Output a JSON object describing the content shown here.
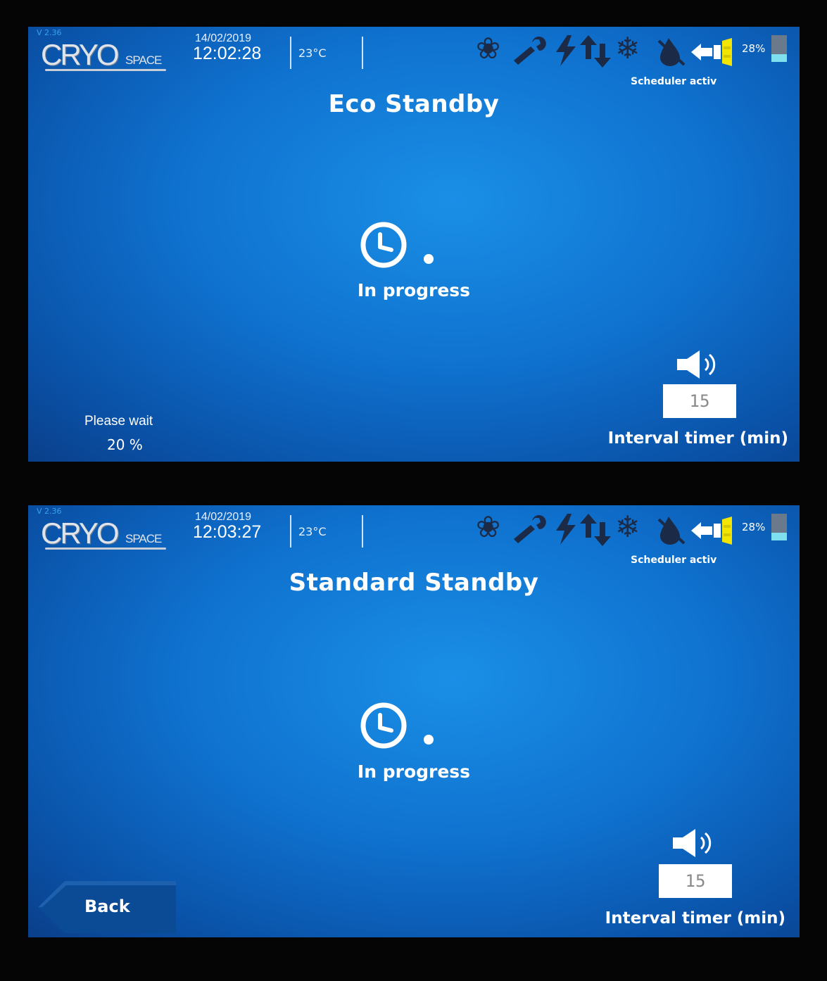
{
  "screens": [
    {
      "version": "V 2.36",
      "logo": {
        "brand": "CRYO",
        "sub": "SPACE"
      },
      "date": "14/02/2019",
      "time": "12:02:28",
      "temperature": "23°C",
      "battery": "28%",
      "battery_level": 0.28,
      "scheduler": "Scheduler activ",
      "title": "Eco Standby",
      "progress_label": "In progress",
      "interval_value": "15",
      "interval_label": "Interval timer (min)",
      "wait_label": "Please wait",
      "wait_value": "20 %"
    },
    {
      "version": "V 2.36",
      "logo": {
        "brand": "CRYO",
        "sub": "SPACE"
      },
      "date": "14/02/2019",
      "time": "12:03:27",
      "temperature": "23°C",
      "battery": "28%",
      "battery_level": 0.28,
      "scheduler": "Scheduler activ",
      "title": "Standard Standby",
      "progress_label": "In progress",
      "interval_value": "15",
      "interval_label": "Interval timer (min)",
      "back_label": "Back"
    }
  ],
  "icons": [
    "fan-icon",
    "wrench-icon",
    "power-icon",
    "arrows-icon",
    "snowflake-icon",
    "drop-icon",
    "cable-icon",
    "clock-icon",
    "speaker-icon",
    "battery-icon",
    "back-arrow-icon"
  ],
  "colors": {
    "screen_blue": "#0f72cf",
    "icon_dark": "#1b2a47",
    "cable_yellow": "#f2e600",
    "battery_fill": "#7ee0ee"
  }
}
